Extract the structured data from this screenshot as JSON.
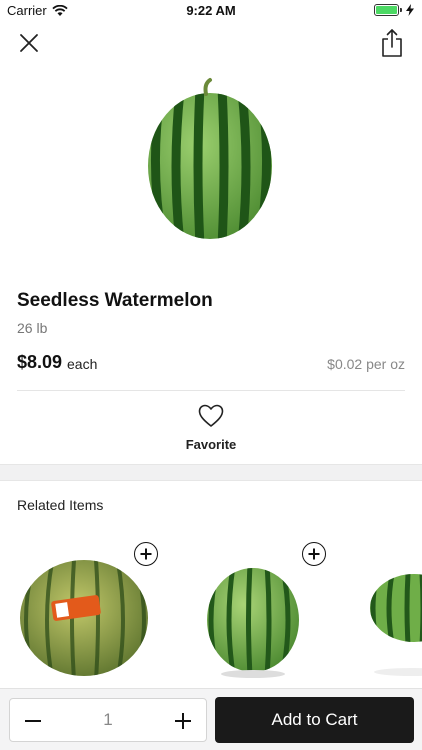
{
  "status_bar": {
    "carrier": "Carrier",
    "time": "9:22 AM",
    "battery_level": 1.0,
    "icons": [
      "wifi-icon",
      "battery-icon",
      "charging-bolt-icon"
    ]
  },
  "nav": {
    "close_icon": "close-icon",
    "share_icon": "share-icon"
  },
  "product": {
    "name": "Seedless Watermelon",
    "weight": "26 lb",
    "price": "$8.09",
    "price_unit": "each",
    "unit_price": "$0.02 per oz"
  },
  "favorite": {
    "label": "Favorite",
    "icon": "heart-outline-icon"
  },
  "related": {
    "title": "Related Items",
    "add_icon": "plus-circle-icon"
  },
  "cart": {
    "quantity": "1",
    "add_label": "Add to Cart"
  },
  "colors": {
    "melon_dark": "#2b6a21",
    "melon_light": "#7fb65a",
    "button_dark": "#1a1a1a",
    "battery_green": "#4cd964",
    "band_gray": "#f1f1f2"
  }
}
